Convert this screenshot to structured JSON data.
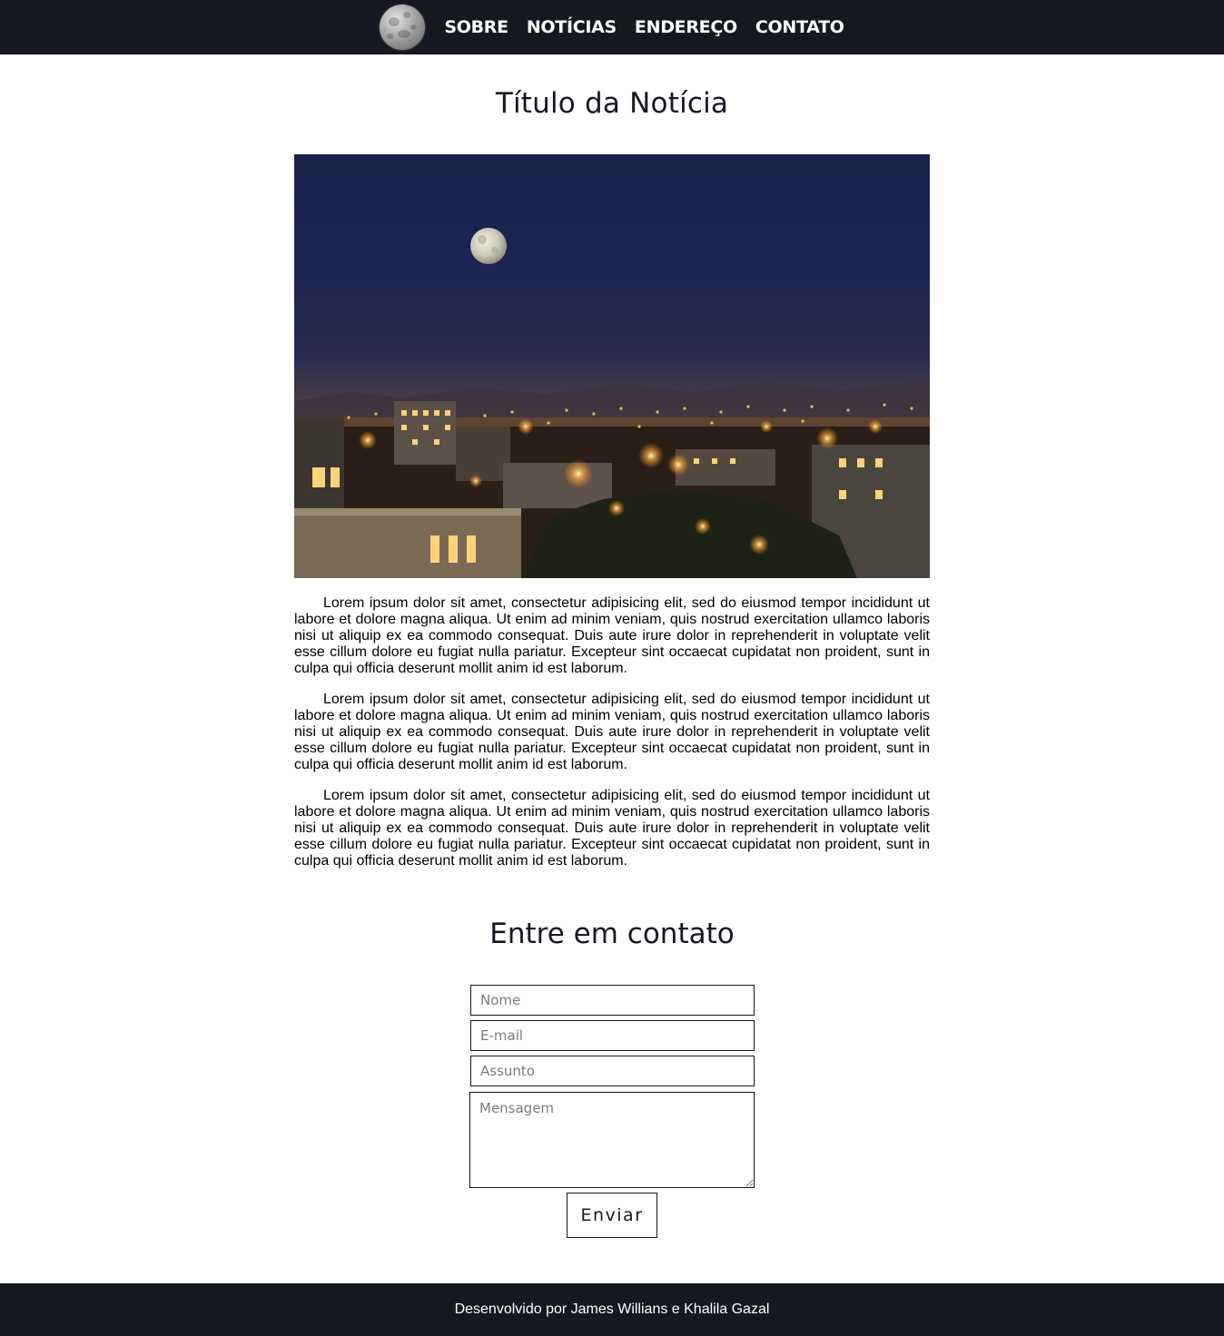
{
  "nav": {
    "logo_icon": "moon-icon",
    "items": [
      {
        "label": "SOBRE"
      },
      {
        "label": "NOTÍCIAS"
      },
      {
        "label": "ENDEREÇO"
      },
      {
        "label": "CONTATO"
      }
    ]
  },
  "article": {
    "title": "Título da Notícia",
    "image_alt": "city-at-night-with-full-moon",
    "paragraphs": [
      "Lorem ipsum dolor sit amet, consectetur adipisicing elit, sed do eiusmod tempor incididunt ut labore et dolore magna aliqua. Ut enim ad minim veniam, quis nostrud exercitation ullamco laboris nisi ut aliquip ex ea commodo consequat. Duis aute irure dolor in reprehenderit in voluptate velit esse cillum dolore eu fugiat nulla pariatur. Excepteur sint occaecat cupidatat non proident, sunt in culpa qui officia deserunt mollit anim id est laborum.",
      "Lorem ipsum dolor sit amet, consectetur adipisicing elit, sed do eiusmod tempor incididunt ut labore et dolore magna aliqua. Ut enim ad minim veniam, quis nostrud exercitation ullamco laboris nisi ut aliquip ex ea commodo consequat. Duis aute irure dolor in reprehenderit in voluptate velit esse cillum dolore eu fugiat nulla pariatur. Excepteur sint occaecat cupidatat non proident, sunt in culpa qui officia deserunt mollit anim id est laborum.",
      "Lorem ipsum dolor sit amet, consectetur adipisicing elit, sed do eiusmod tempor incididunt ut labore et dolore magna aliqua. Ut enim ad minim veniam, quis nostrud exercitation ullamco laboris nisi ut aliquip ex ea commodo consequat. Duis aute irure dolor in reprehenderit in voluptate velit esse cillum dolore eu fugiat nulla pariatur. Excepteur sint occaecat cupidatat non proident, sunt in culpa qui officia deserunt mollit anim id est laborum."
    ]
  },
  "contact": {
    "title": "Entre em contato",
    "name_placeholder": "Nome",
    "email_placeholder": "E-mail",
    "subject_placeholder": "Assunto",
    "message_placeholder": "Mensagem",
    "submit_label": "Enviar"
  },
  "footer": {
    "text": "Desenvolvido por James Willians e Khalila Gazal"
  },
  "colors": {
    "header_bg": "#151821",
    "footer_bg": "#151821",
    "text_dark": "#151821"
  }
}
